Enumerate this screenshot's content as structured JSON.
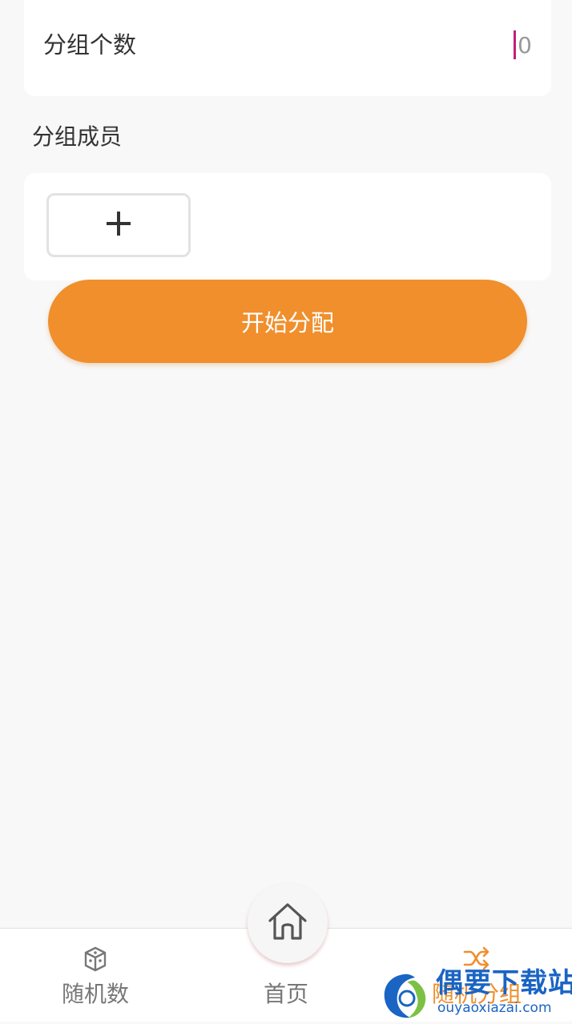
{
  "group_count": {
    "label": "分组个数",
    "value": "0"
  },
  "members": {
    "section_title": "分组成员",
    "add_icon": "plus-icon"
  },
  "start_button": {
    "label": "开始分配"
  },
  "tabbar": {
    "tabs": [
      {
        "label": "随机数",
        "icon": "dice-icon",
        "active": false
      },
      {
        "label": "首页",
        "icon": "home-icon",
        "active": false
      },
      {
        "label": "随机分组",
        "icon": "shuffle-icon",
        "active": true
      }
    ]
  },
  "watermark": {
    "title": "偶要下载站",
    "domain": "ouyaoxiazai.com"
  },
  "colors": {
    "accent": "#f08f2c",
    "background": "#f8f8f8",
    "card": "#ffffff",
    "caret": "#c0207a",
    "watermark": "#1a64c4"
  }
}
